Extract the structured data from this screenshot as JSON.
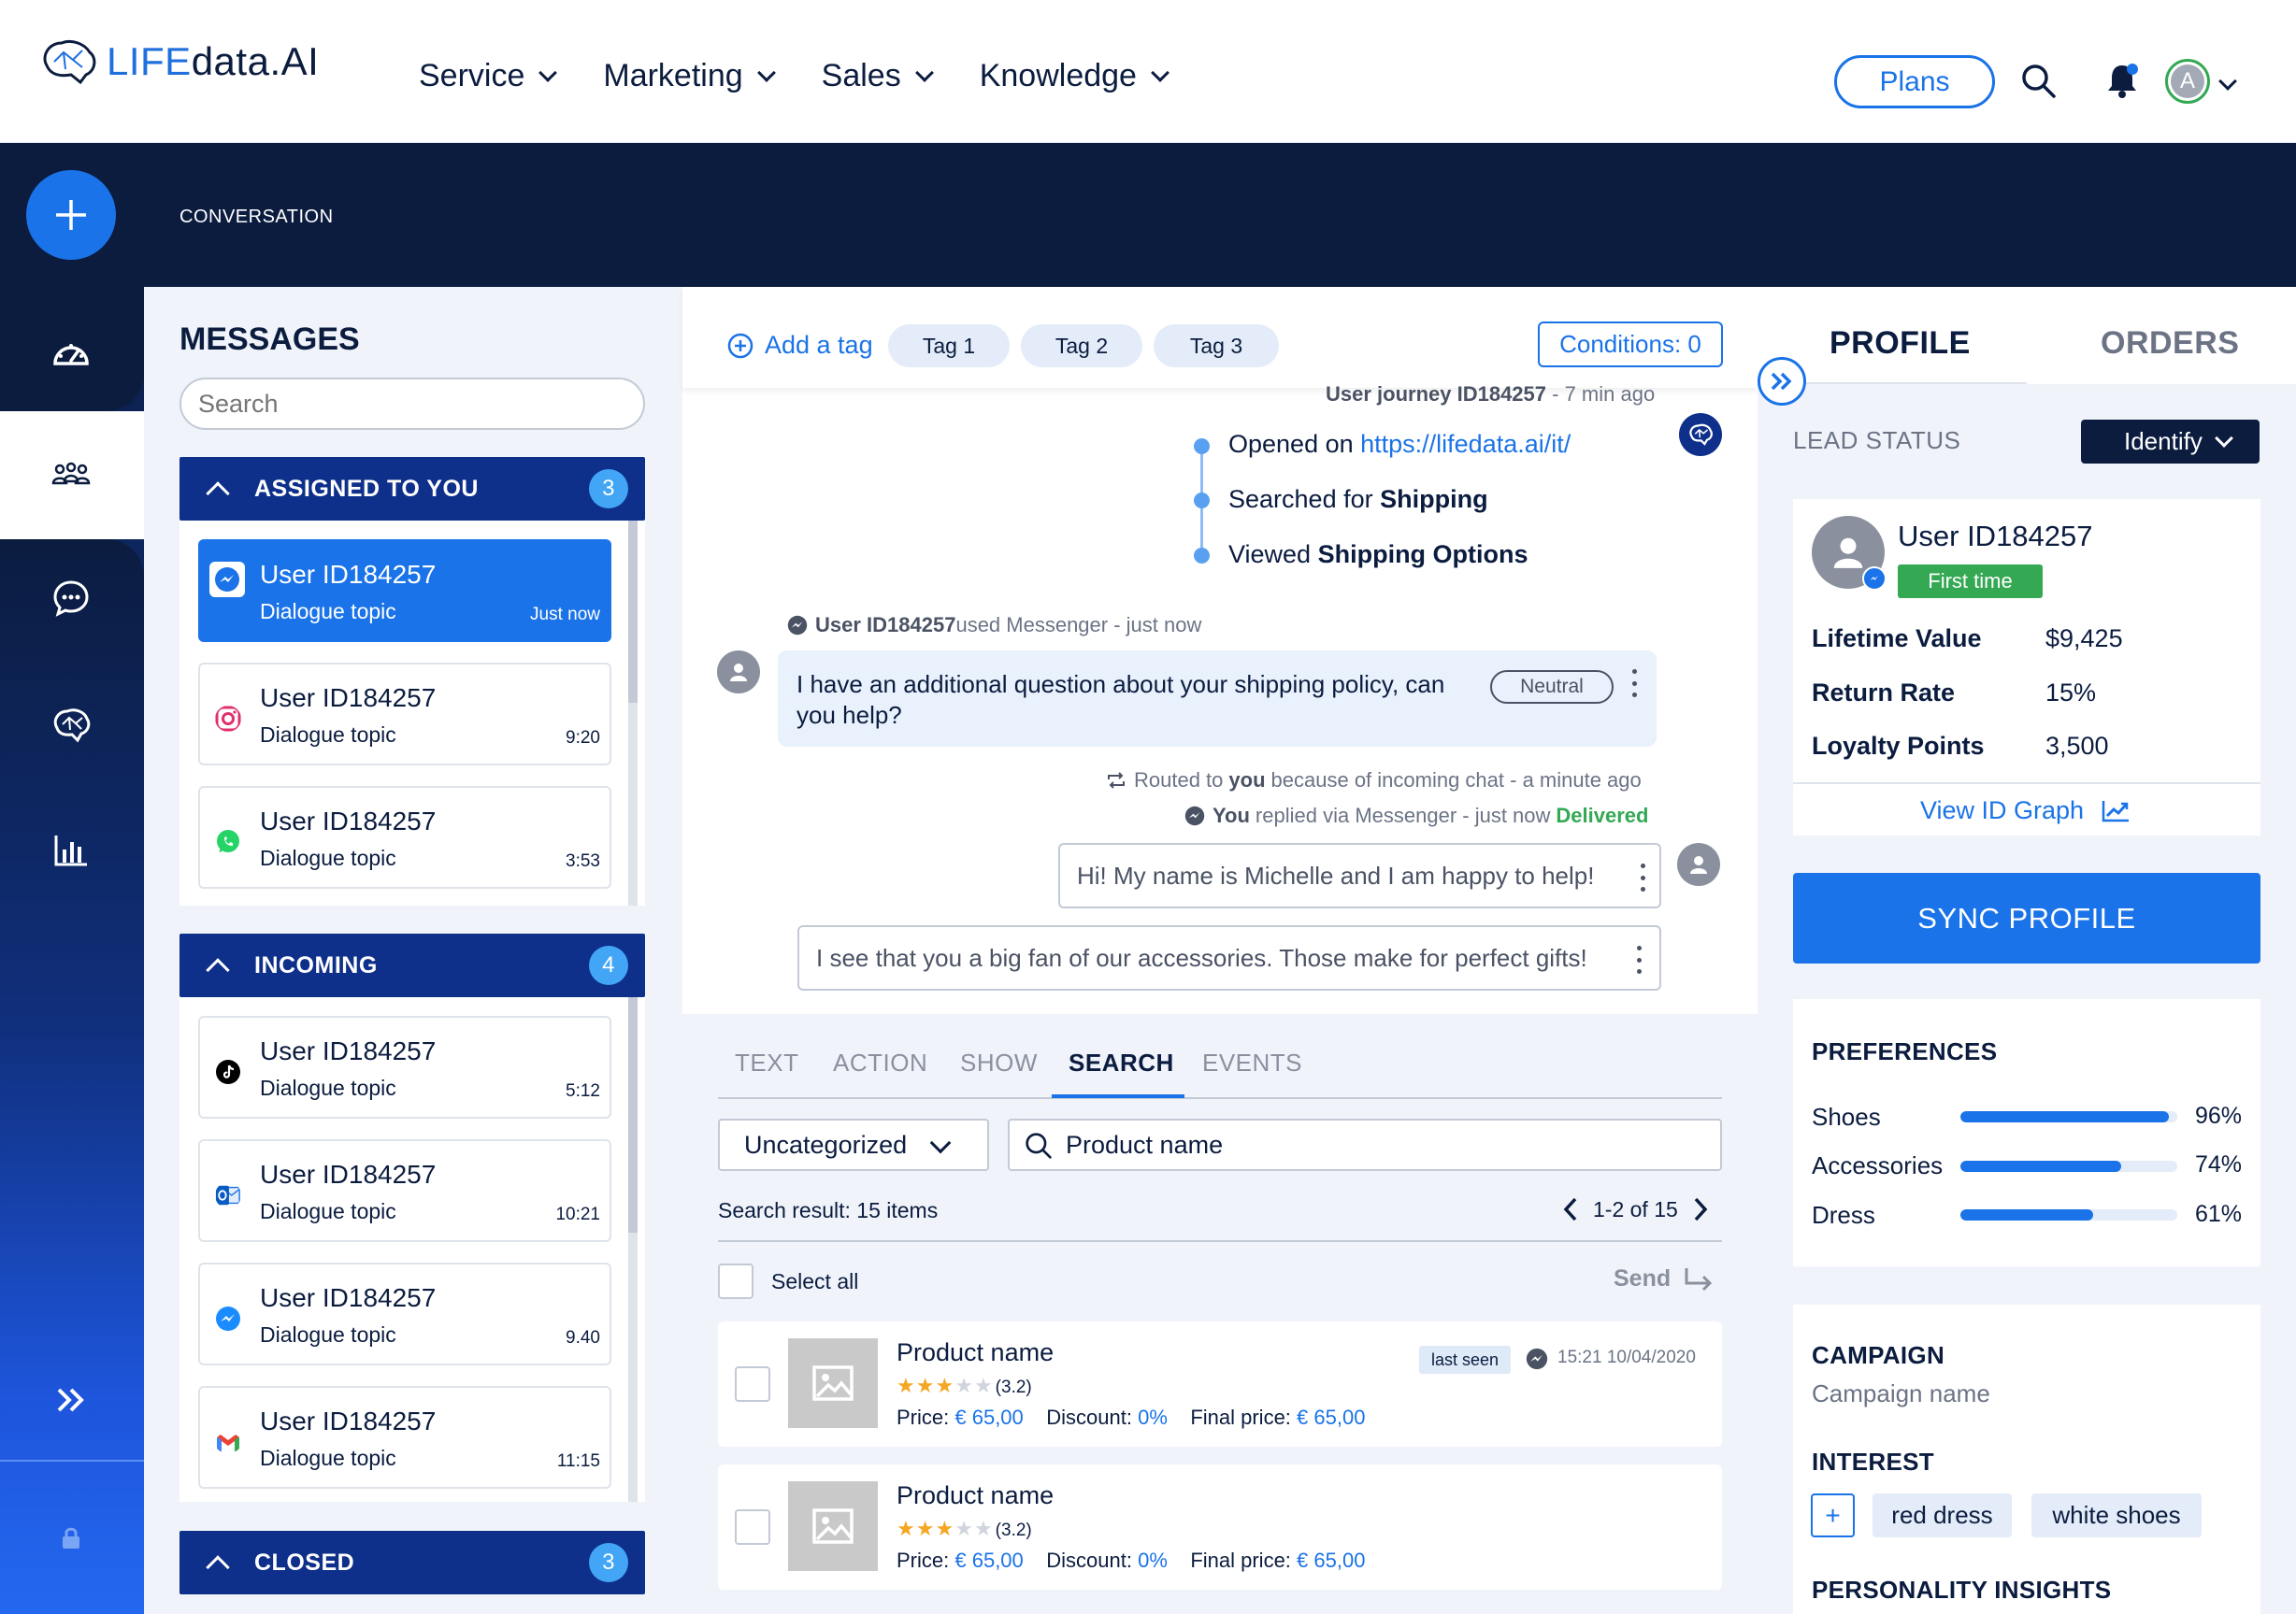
{
  "app": {
    "logo_prefix": "LIFE",
    "logo_suffix": "data.AI",
    "nav": [
      {
        "label": "Service"
      },
      {
        "label": "Marketing"
      },
      {
        "label": "Sales"
      },
      {
        "label": "Knowledge"
      }
    ],
    "plans_label": "Plans",
    "user_initial": "A",
    "section_title": "CONVERSATION"
  },
  "messages": {
    "title": "MESSAGES",
    "search_placeholder": "Search",
    "assigned": {
      "label": "ASSIGNED TO YOU",
      "count": "3",
      "items": [
        {
          "name": "User ID184257",
          "topic": "Dialogue topic",
          "time": "Just now",
          "channel": "messenger"
        },
        {
          "name": "User ID184257",
          "topic": "Dialogue topic",
          "time": "9:20",
          "channel": "instagram"
        },
        {
          "name": "User ID184257",
          "topic": "Dialogue topic",
          "time": "3:53",
          "channel": "whatsapp"
        }
      ]
    },
    "incoming": {
      "label": "INCOMING",
      "count": "4",
      "items": [
        {
          "name": "User ID184257",
          "topic": "Dialogue topic",
          "time": "5:12",
          "channel": "tiktok"
        },
        {
          "name": "User ID184257",
          "topic": "Dialogue topic",
          "time": "10:21",
          "channel": "outlook"
        },
        {
          "name": "User ID184257",
          "topic": "Dialogue topic",
          "time": "9.40",
          "channel": "messenger"
        },
        {
          "name": "User ID184257",
          "topic": "Dialogue topic",
          "time": "11:15",
          "channel": "gmail"
        }
      ]
    },
    "closed": {
      "label": "CLOSED",
      "count": "3"
    }
  },
  "chat": {
    "add_tag": "Add a tag",
    "tags": [
      "Tag 1",
      "Tag 2",
      "Tag 3"
    ],
    "conditions": "Conditions: 0",
    "journey_user": "User journey ID184257",
    "journey_time": " - 7 min ago",
    "journey": [
      {
        "prefix": "Opened on ",
        "value": "https://lifedata.ai/it/"
      },
      {
        "prefix": "Searched for ",
        "value": "Shipping"
      },
      {
        "prefix": "Viewed ",
        "value": "Shipping Options"
      }
    ],
    "incoming_meta_user": "User ID184257",
    "incoming_meta_rest": " used Messenger - just now",
    "incoming_text": "I have an additional question about your shipping policy, can you help?",
    "sentiment": "Neutral",
    "routed_pre": "Routed to ",
    "routed_you": "you",
    "routed_post": " because of incoming chat - a minute ago",
    "replied_you": "You",
    "replied_post": " replied via Messenger - just now ",
    "replied_status": "Delivered",
    "out_1": "Hi! My name is Michelle and I am happy to help!",
    "out_2": "I see that you a big fan of our accessories. Those make for perfect gifts!"
  },
  "composer": {
    "tabs": [
      "TEXT",
      "ACTION",
      "SHOW",
      "SEARCH",
      "EVENTS"
    ],
    "active_tab": "SEARCH",
    "category": "Uncategorized",
    "search_value": "Product name",
    "result_text": "Search result: 15 items",
    "pager": "1-2 of 15",
    "select_all": "Select all",
    "send": "Send",
    "products": [
      {
        "name": "Product name",
        "rating": "(3.2)",
        "rating_value": 3.2,
        "price_label": "Price:",
        "price": "€ 65,00",
        "discount_label": "Discount:",
        "discount": "0%",
        "final_label": "Final price:",
        "final": "€ 65,00",
        "last_seen": "last seen",
        "seen_time": "15:21 10/04/2020"
      },
      {
        "name": "Product name",
        "rating": "(3.2)",
        "rating_value": 3.2,
        "price_label": "Price:",
        "price": "€ 65,00",
        "discount_label": "Discount:",
        "discount": "0%",
        "final_label": "Final price:",
        "final": "€ 65,00"
      }
    ]
  },
  "profile": {
    "tabs": [
      "PROFILE",
      "ORDERS"
    ],
    "lead_status_label": "LEAD STATUS",
    "lead_status_value": "Identify",
    "user": "User ID184257",
    "badge": "First time",
    "stats": [
      {
        "label": "Lifetime Value",
        "value": "$9,425"
      },
      {
        "label": "Return Rate",
        "value": "15%"
      },
      {
        "label": "Loyalty Points",
        "value": "3,500"
      }
    ],
    "view_graph": "View ID Graph",
    "sync": "SYNC PROFILE",
    "preferences_title": "PREFERENCES",
    "preferences": [
      {
        "label": "Shoes",
        "pct": "96%",
        "value": 0.96
      },
      {
        "label": "Accessories",
        "pct": "74%",
        "value": 0.74
      },
      {
        "label": "Dress",
        "pct": "61%",
        "value": 0.61
      }
    ],
    "campaign_title": "CAMPAIGN",
    "campaign_name": "Campaign name",
    "interest_title": "INTEREST",
    "interests": [
      "red dress",
      "white shoes"
    ],
    "insights_title": "PERSONALITY INSIGHTS"
  },
  "colors": {
    "primary": "#1a73e8",
    "navy": "#0b1c3f",
    "section": "#0e2f8a",
    "success": "#34a853"
  }
}
